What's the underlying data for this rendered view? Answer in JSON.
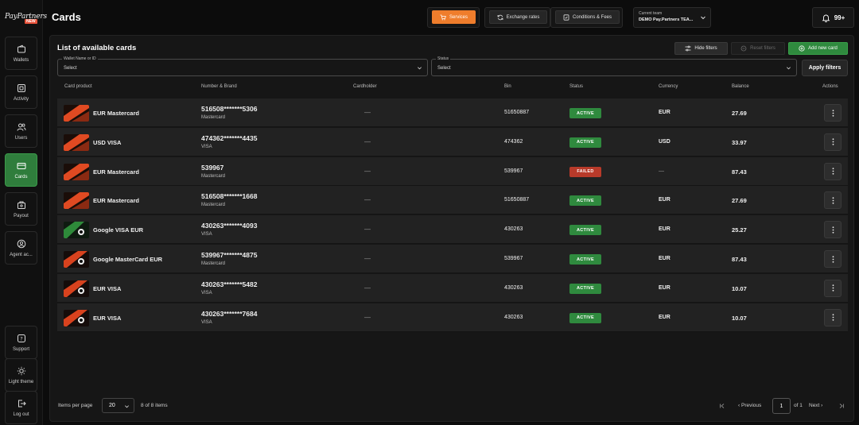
{
  "app": {
    "logo_text": "PayPartners",
    "logo_badge": "NEW",
    "page_title": "Cards"
  },
  "sidebar": {
    "items": [
      {
        "label": "Wallets",
        "icon": "wallet-icon",
        "active": false
      },
      {
        "label": "Activity",
        "icon": "activity-icon",
        "active": false
      },
      {
        "label": "Users",
        "icon": "users-icon",
        "active": false
      },
      {
        "label": "Cards",
        "icon": "card-icon",
        "active": true
      },
      {
        "label": "Payout",
        "icon": "payout-icon",
        "active": false
      },
      {
        "label": "Agent ac...",
        "icon": "agent-icon",
        "active": false
      }
    ],
    "bottom": [
      {
        "label": "Support",
        "icon": "support-icon"
      },
      {
        "label": "Light theme",
        "icon": "sun-icon"
      },
      {
        "label": "Log out",
        "icon": "logout-icon"
      }
    ]
  },
  "header": {
    "services_label": "Services",
    "exchange_label": "Exchange rates",
    "conditions_label": "Conditions & Fees",
    "team_label": "Current team",
    "team_value": "DEMO Pay.Partners TEA...",
    "notifications": "99+"
  },
  "panel": {
    "title": "List of available cards",
    "hide_filters": "Hide filters",
    "reset_filters": "Reset filters",
    "add_card": "Add new card",
    "filters": {
      "wallet_label": "Wallet Name or ID",
      "wallet_value": "Select",
      "status_label": "Status",
      "status_value": "Select",
      "apply": "Apply filters"
    }
  },
  "table": {
    "columns": [
      "Card product",
      "Number & Brand",
      "Cardholder",
      "Bin",
      "Status",
      "Currency",
      "Balance",
      "Actions"
    ],
    "rows": [
      {
        "product": "EUR Mastercard",
        "number": "516508*******5306",
        "brand": "Mastercard",
        "cardholder": "—",
        "bin": "51650887",
        "status": "ACTIVE",
        "currency": "EUR",
        "balance": "27.69",
        "thumb": "orange"
      },
      {
        "product": "USD VISA",
        "number": "474362*******4435",
        "brand": "VISA",
        "cardholder": "—",
        "bin": "474362",
        "status": "ACTIVE",
        "currency": "USD",
        "balance": "33.97",
        "thumb": "orange"
      },
      {
        "product": "EUR Mastercard",
        "number": "539967",
        "brand": "Mastercard",
        "cardholder": "—",
        "bin": "539967",
        "status": "FAILED",
        "currency": "—",
        "balance": "87.43",
        "thumb": "orange"
      },
      {
        "product": "EUR Mastercard",
        "number": "516508*******1668",
        "brand": "Mastercard",
        "cardholder": "—",
        "bin": "51650887",
        "status": "ACTIVE",
        "currency": "EUR",
        "balance": "27.69",
        "thumb": "orange"
      },
      {
        "product": "Google VISA EUR",
        "number": "430263*******4093",
        "brand": "VISA",
        "cardholder": "—",
        "bin": "430263",
        "status": "ACTIVE",
        "currency": "EUR",
        "balance": "25.27",
        "thumb": "green"
      },
      {
        "product": "Google MasterCard EUR",
        "number": "539967*******4875",
        "brand": "Mastercard",
        "cardholder": "—",
        "bin": "539967",
        "status": "ACTIVE",
        "currency": "EUR",
        "balance": "87.43",
        "thumb": "mixed"
      },
      {
        "product": "EUR VISA",
        "number": "430263*******5482",
        "brand": "VISA",
        "cardholder": "—",
        "bin": "430263",
        "status": "ACTIVE",
        "currency": "EUR",
        "balance": "10.07",
        "thumb": "mixed"
      },
      {
        "product": "EUR VISA",
        "number": "430263*******7684",
        "brand": "VISA",
        "cardholder": "—",
        "bin": "430263",
        "status": "ACTIVE",
        "currency": "EUR",
        "balance": "10.07",
        "thumb": "mixed"
      }
    ]
  },
  "footer": {
    "per_page_label": "Items per page",
    "per_page_value": "20",
    "items_info": "8 of 8 items",
    "previous": "Previous",
    "page": "1",
    "of_pages": "of 1",
    "next": "Next"
  },
  "colors": {
    "active": "#2f8a3e",
    "failed": "#b83a2a",
    "accent": "#ef7d2c",
    "nav_active": "#2f7d3c"
  }
}
